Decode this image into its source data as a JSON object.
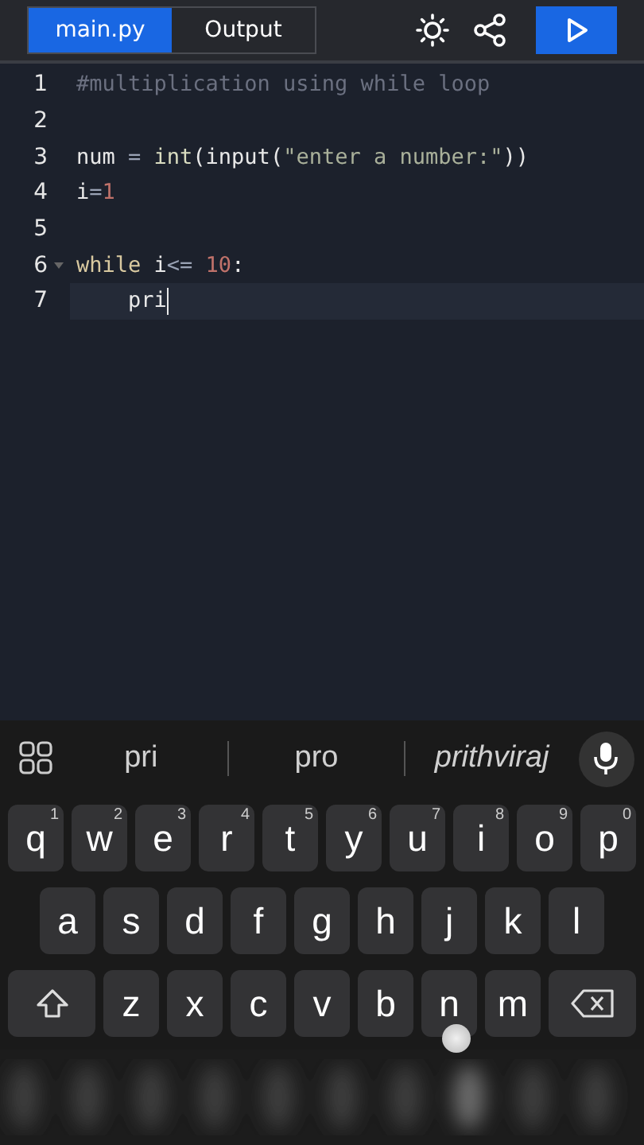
{
  "tabs": [
    {
      "label": "main.py",
      "selected": true
    },
    {
      "label": "Output",
      "selected": false
    }
  ],
  "code": [
    {
      "number": "1",
      "active": false,
      "foldable": false,
      "tokens": [
        {
          "kind": "comment",
          "text": "#multiplication using while loop"
        }
      ]
    },
    {
      "number": "2",
      "active": false,
      "foldable": false
    },
    {
      "number": "3",
      "active": false,
      "foldable": false,
      "tokens": [
        {
          "kind": "plain",
          "text": "num"
        },
        {
          "kind": "operator",
          "text": " = "
        },
        {
          "kind": "builtin",
          "text": "int"
        },
        {
          "kind": "plain",
          "text": "(input("
        },
        {
          "kind": "string",
          "text": "\"enter a number:\""
        },
        {
          "kind": "plain",
          "text": "))"
        }
      ]
    },
    {
      "number": "4",
      "active": false,
      "foldable": false,
      "tokens": [
        {
          "kind": "plain",
          "text": "i"
        },
        {
          "kind": "operator",
          "text": "="
        },
        {
          "kind": "number",
          "text": "1"
        }
      ]
    },
    {
      "number": "5",
      "active": false,
      "foldable": false
    },
    {
      "number": "6",
      "active": false,
      "foldable": true,
      "tokens": [
        {
          "kind": "keyword",
          "text": "while"
        },
        {
          "kind": "plain",
          "text": " i"
        },
        {
          "kind": "operator",
          "text": "<= "
        },
        {
          "kind": "number",
          "text": "10"
        },
        {
          "kind": "plain",
          "text": ":"
        }
      ]
    },
    {
      "number": "7",
      "active": true,
      "foldable": false,
      "tokens": [
        {
          "kind": "plain",
          "text": "    pri"
        }
      ]
    }
  ],
  "suggestions": [
    {
      "kind": "word",
      "text": "pri"
    },
    {
      "kind": "word",
      "text": "pro"
    },
    {
      "kind": "contact",
      "text": "prithviraj"
    }
  ],
  "keyboard": [
    [
      {
        "kind": "letter",
        "label": "q",
        "hint": "1"
      },
      {
        "kind": "letter",
        "label": "w",
        "hint": "2"
      },
      {
        "kind": "letter",
        "label": "e",
        "hint": "3"
      },
      {
        "kind": "letter",
        "label": "r",
        "hint": "4"
      },
      {
        "kind": "letter",
        "label": "t",
        "hint": "5"
      },
      {
        "kind": "letter",
        "label": "y",
        "hint": "6"
      },
      {
        "kind": "letter",
        "label": "u",
        "hint": "7"
      },
      {
        "kind": "letter",
        "label": "i",
        "hint": "8"
      },
      {
        "kind": "letter",
        "label": "o",
        "hint": "9"
      },
      {
        "kind": "letter",
        "label": "p",
        "hint": "0"
      }
    ],
    [
      {
        "kind": "letter",
        "label": "a"
      },
      {
        "kind": "letter",
        "label": "s"
      },
      {
        "kind": "letter",
        "label": "d"
      },
      {
        "kind": "letter",
        "label": "f"
      },
      {
        "kind": "letter",
        "label": "g"
      },
      {
        "kind": "letter",
        "label": "h"
      },
      {
        "kind": "letter",
        "label": "j"
      },
      {
        "kind": "letter",
        "label": "k"
      },
      {
        "kind": "letter",
        "label": "l"
      }
    ],
    [
      {
        "kind": "shift"
      },
      {
        "kind": "letter",
        "label": "z"
      },
      {
        "kind": "letter",
        "label": "x"
      },
      {
        "kind": "letter",
        "label": "c"
      },
      {
        "kind": "letter",
        "label": "v"
      },
      {
        "kind": "letter",
        "label": "b"
      },
      {
        "kind": "letter",
        "label": "n",
        "touched": true
      },
      {
        "kind": "letter",
        "label": "m"
      },
      {
        "kind": "backspace"
      }
    ]
  ]
}
